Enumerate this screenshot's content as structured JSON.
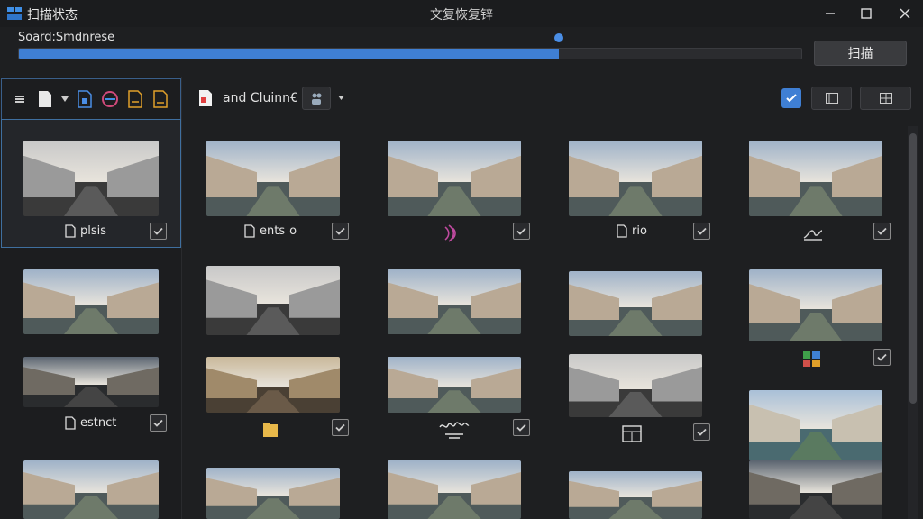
{
  "app": {
    "title": "扫描状态",
    "window_title": "文复恢复锌"
  },
  "scan": {
    "label": "Soard:Smdnrese",
    "progress": 0.69,
    "button_label": "扫描"
  },
  "path": {
    "text": "and Cluinn€"
  },
  "colors": {
    "accent": "#3f7fd4",
    "panel": "#1e1f21",
    "border": "#3a5f8a"
  },
  "window_controls": [
    "minimize-icon",
    "maximize-icon",
    "close-icon"
  ],
  "captions": {
    "c1": "plsis",
    "c2": "ents",
    "c2b": "o",
    "c3": "rio",
    "c4": "estnct"
  }
}
